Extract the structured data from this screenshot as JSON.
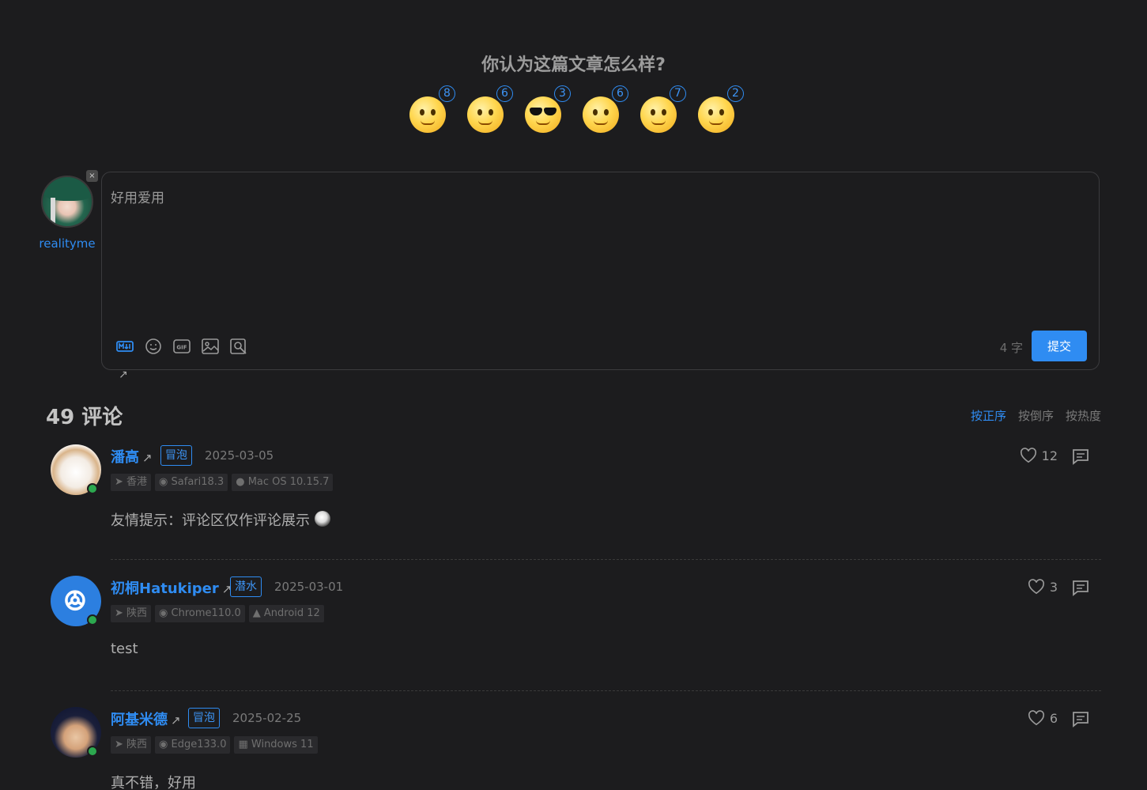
{
  "reactions": {
    "title": "你认为这篇文章怎么样?",
    "items": [
      {
        "name": "angry-face",
        "count": "8"
      },
      {
        "name": "hug-face",
        "count": "6"
      },
      {
        "name": "cool-face",
        "count": "3"
      },
      {
        "name": "shy-face",
        "count": "6"
      },
      {
        "name": "speechless-face",
        "count": "7"
      },
      {
        "name": "sleepy-face",
        "count": "2"
      }
    ]
  },
  "user": {
    "name": "realityme",
    "close_label": "×"
  },
  "editor": {
    "value": "好用爱用",
    "word_count": "4 字",
    "submit_label": "提交",
    "md_link": "↗",
    "tools": [
      "markdown-icon",
      "emoji-icon",
      "gif-icon",
      "image-icon",
      "preview-icon"
    ]
  },
  "comments_header": {
    "count_label": "49 评论",
    "sort_options": [
      "按正序",
      "按倒序",
      "按热度"
    ]
  },
  "comments": [
    {
      "name": "潘高",
      "arrow": "↗",
      "badge": "冒泡",
      "date": "2025-03-05",
      "location": "香港",
      "browser": "Safari18.3",
      "os": "Mac OS 10.15.7",
      "text": "友情提示：评论区仅作评论展示",
      "likes": "12"
    },
    {
      "name": "初桐Hatukiper",
      "arrow": "↗",
      "badge": "潜水",
      "date": "2025-03-01",
      "location": "陕西",
      "browser": "Chrome110.0",
      "os": "Android 12",
      "text": "test",
      "likes": "3"
    },
    {
      "name": "阿基米德",
      "arrow": "↗",
      "badge": "冒泡",
      "date": "2025-02-25",
      "location": "陕西",
      "browser": "Edge133.0",
      "os": "Windows 11",
      "text": "真不错，好用",
      "likes": "6"
    }
  ],
  "colors": {
    "background": "#1c1c1e",
    "accent": "#2f8cf2",
    "verified": "#2ca84f"
  }
}
